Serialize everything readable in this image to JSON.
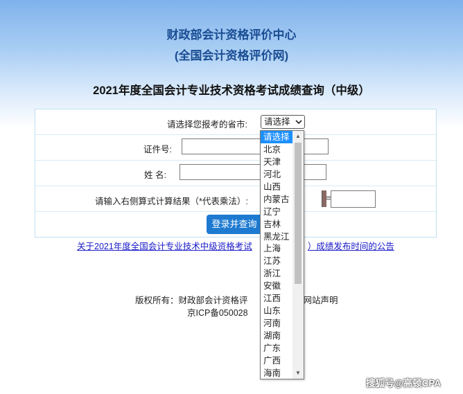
{
  "header": {
    "title": "财政部会计资格评价中心",
    "subtitle": "(全国会计资格评价网)"
  },
  "page_title": "2021年度全国会计专业技术资格考试成绩查询（中级）",
  "form": {
    "province_label": "请选择您报考的省市:",
    "province_selected": "请选择",
    "id_label": "证件号:",
    "name_label": "姓 名:",
    "captcha_label": "请输入右侧算式计算结果（*代表乘法）:",
    "equals": "=",
    "submit_label": "登录并查询"
  },
  "province_options": [
    "请选择",
    "北京",
    "天津",
    "河北",
    "山西",
    "内蒙古",
    "辽宁",
    "吉林",
    "黑龙江",
    "上海",
    "江苏",
    "浙江",
    "安徽",
    "江西",
    "山东",
    "河南",
    "湖南",
    "广东",
    "广西",
    "海南"
  ],
  "notice_link": "关于2021年度全国会计专业技术中级资格考试",
  "notice_link_tail": "）成绩发布时间的公告",
  "footer": {
    "copyright": "版权所有：财政部会计资格评",
    "copyright_tail": "网站声明",
    "icp": "京ICP备050028"
  },
  "watermark": "搜狐号@高顿CPA"
}
